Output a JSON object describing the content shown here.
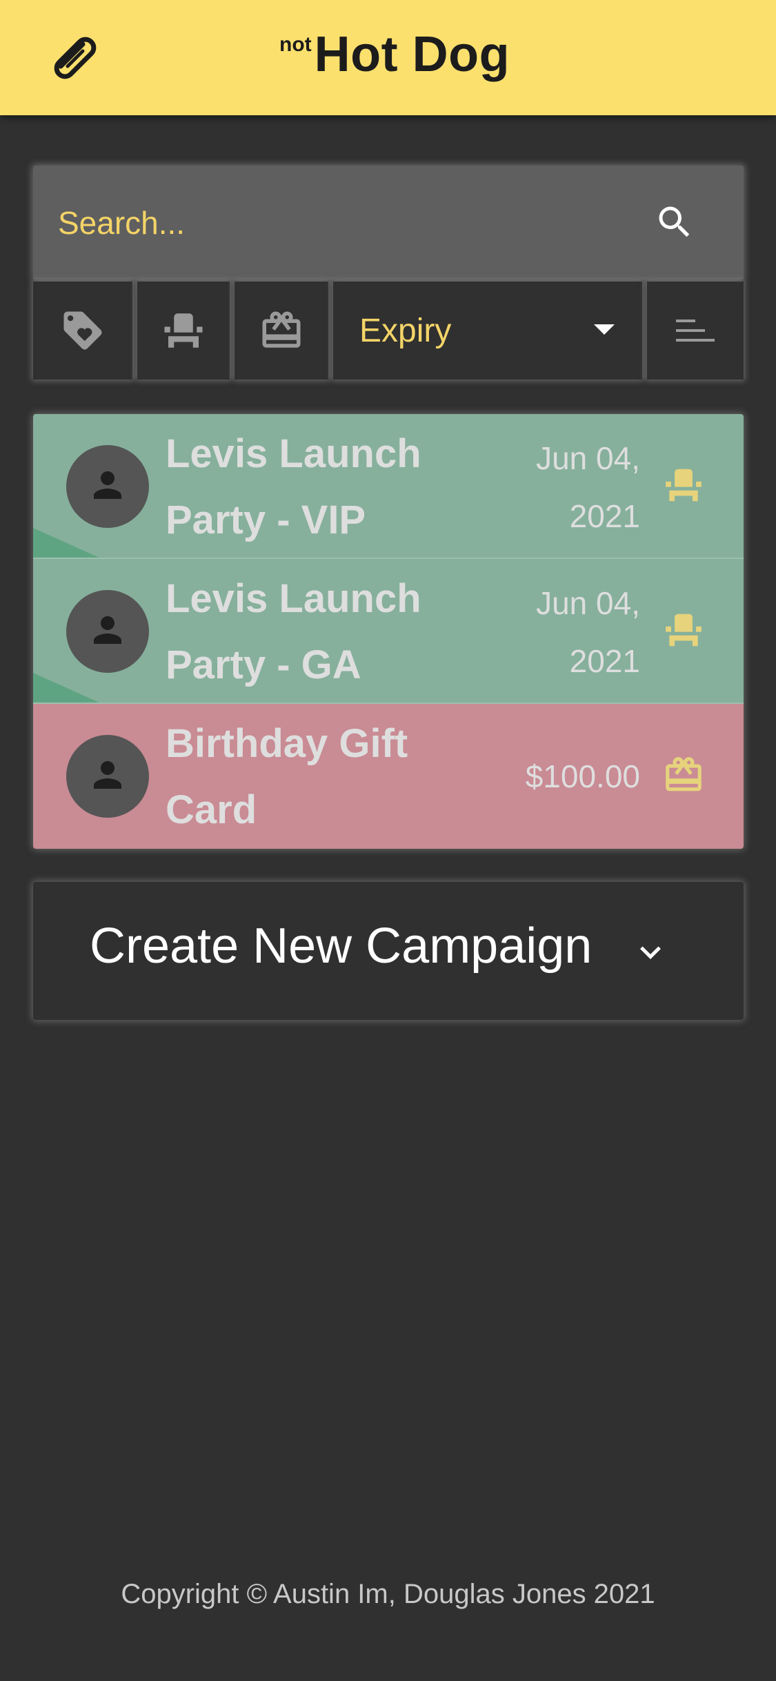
{
  "header": {
    "logo_icon": "hotdog-icon",
    "brand_prefix": "not",
    "brand_name": "Hot Dog"
  },
  "search": {
    "placeholder": "Search...",
    "icon": "search-icon"
  },
  "filters": {
    "buttons": [
      {
        "icon": "tag-heart-icon"
      },
      {
        "icon": "seat-icon"
      },
      {
        "icon": "gift-card-icon"
      }
    ],
    "sort_selected": "Expiry",
    "sort_icon": "sort-lines-icon"
  },
  "campaigns": [
    {
      "title": "Levis Launch Party - VIP",
      "meta": "Jun 04, 2021",
      "type_icon": "seat-icon",
      "color": "#86b09c"
    },
    {
      "title": "Levis Launch Party - GA",
      "meta": "Jun 04, 2021",
      "type_icon": "seat-icon",
      "color": "#86b09c"
    },
    {
      "title": "Birthday Gift Card",
      "meta": "$100.00",
      "type_icon": "gift-card-icon",
      "color": "#c98b94"
    }
  ],
  "create_button": {
    "label": "Create New Campaign",
    "icon": "chevron-down-icon"
  },
  "footer": {
    "copyright": "Copyright © Austin Im, Douglas Jones 2021"
  },
  "colors": {
    "accent": "#fbe06e",
    "background": "#303030",
    "ticket": "#86b09c",
    "giftcard": "#c98b94"
  }
}
